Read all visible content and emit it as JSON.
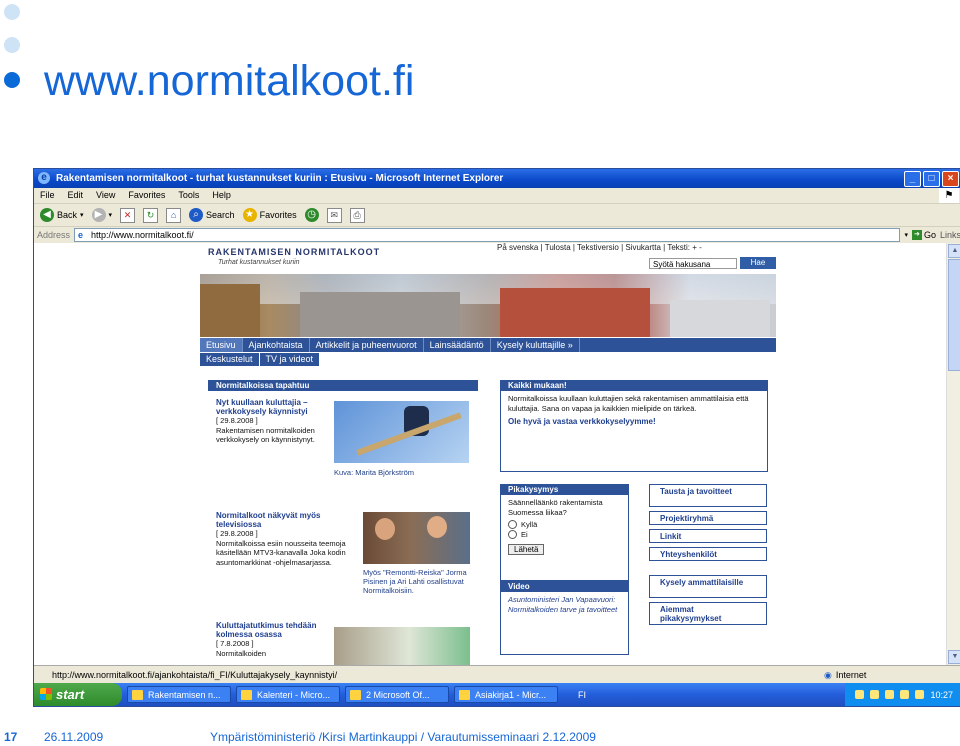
{
  "slide": {
    "title": "www.normitalkoot.fi",
    "page_number": "17",
    "date": "26.11.2009",
    "footer": "Ympäristöministeriö /Kirsi Martinkauppi / Varautumisseminaari 2.12.2009"
  },
  "browser": {
    "title": "Rakentamisen normitalkoot - turhat kustannukset kuriin : Etusivu - Microsoft Internet Explorer",
    "menu": [
      "File",
      "Edit",
      "View",
      "Favorites",
      "Tools",
      "Help"
    ],
    "toolbar": {
      "back": "Back",
      "search": "Search",
      "favorites": "Favorites"
    },
    "address_label": "Address",
    "address": "http://www.normitalkoot.fi/",
    "go": "Go",
    "links": "Links",
    "status_url": "http://www.normitalkoot.fi/ajankohtaista/fi_FI/Kuluttajakysely_kaynnistyi/",
    "status_zone": "Internet"
  },
  "taskbar": {
    "start": "start",
    "tasks": [
      "Rakentamisen n...",
      "Kalenteri - Micro...",
      "2 Microsoft Of...",
      "Asiakirja1 - Micr..."
    ],
    "lang": "FI",
    "time": "10:27"
  },
  "site": {
    "logo": "RAKENTAMISEN NORMITALKOOT",
    "tagline": "Turhat kustannukset kuriin",
    "toplinks": "På svenska  |  Tulosta  |  Tekstiversio  |  Sivukartta  |  Teksti: + -",
    "search_placeholder": "Syötä hakusana",
    "search_button": "Hae",
    "nav": [
      "Etusivu",
      "Ajankohtaista",
      "Artikkelit ja puheenvuorot",
      "Lainsäädäntö",
      "Kysely kuluttajille »"
    ],
    "nav2": [
      "Keskustelut",
      "TV ja videot"
    ],
    "left_header": "Normitalkoissa tapahtuu",
    "news": [
      {
        "title": "Nyt kuullaan kuluttajia – verkkokysely käynnistyi",
        "date": "[ 29.8.2008 ]",
        "text": "Rakentamisen normitalkoiden verkkokysely on käynnistynyt."
      },
      {
        "title": "Normitalkoot näkyvät myös televisiossa",
        "date": "[ 29.8.2008 ]",
        "text": "Normitalkoissa esiin nousseita teemoja käsitellään MTV3-kanavalla Joka kodin asuntomarkkinat -ohjelmasarjassa."
      },
      {
        "title": "Kuluttajatutkimus tehdään kolmessa osassa",
        "date": "[ 7.8.2008 ]",
        "text": "Normitalkoiden"
      }
    ],
    "caption1": "Kuva: Marita Björkström",
    "caption2": "Myös \"Remontti-Reiska\" Jorma Pisinen ja Ari Lahti osallistuvat Normitalkoisiin.",
    "right_header": "Kaikki mukaan!",
    "right_text": "Normitalkoissa kuullaan kuluttajien sekä rakentamisen ammattilaisia että kuluttajia. Sana on vapaa ja kaikkien mielipide on tärkeä.",
    "right_bold": "Ole hyvä ja vastaa verkkokyselyymme!",
    "poll_header": "Pikakysymys",
    "poll_question": "Säännelläänkö rakentamista Suomessa liikaa?",
    "poll_options": [
      "Kyllä",
      "Ei"
    ],
    "poll_button": "Lähetä",
    "video_header": "Video",
    "video_text": "Asuntoministeri Jan Vapaavuori: Normitalkoiden tarve ja tavoitteet",
    "side_links": [
      "Tausta ja tavoitteet",
      "Projektiryhmä",
      "Linkit",
      "Yhteyshenkilöt",
      "Kysely ammattilaisille",
      "Aiemmat pikakysymykset"
    ]
  }
}
